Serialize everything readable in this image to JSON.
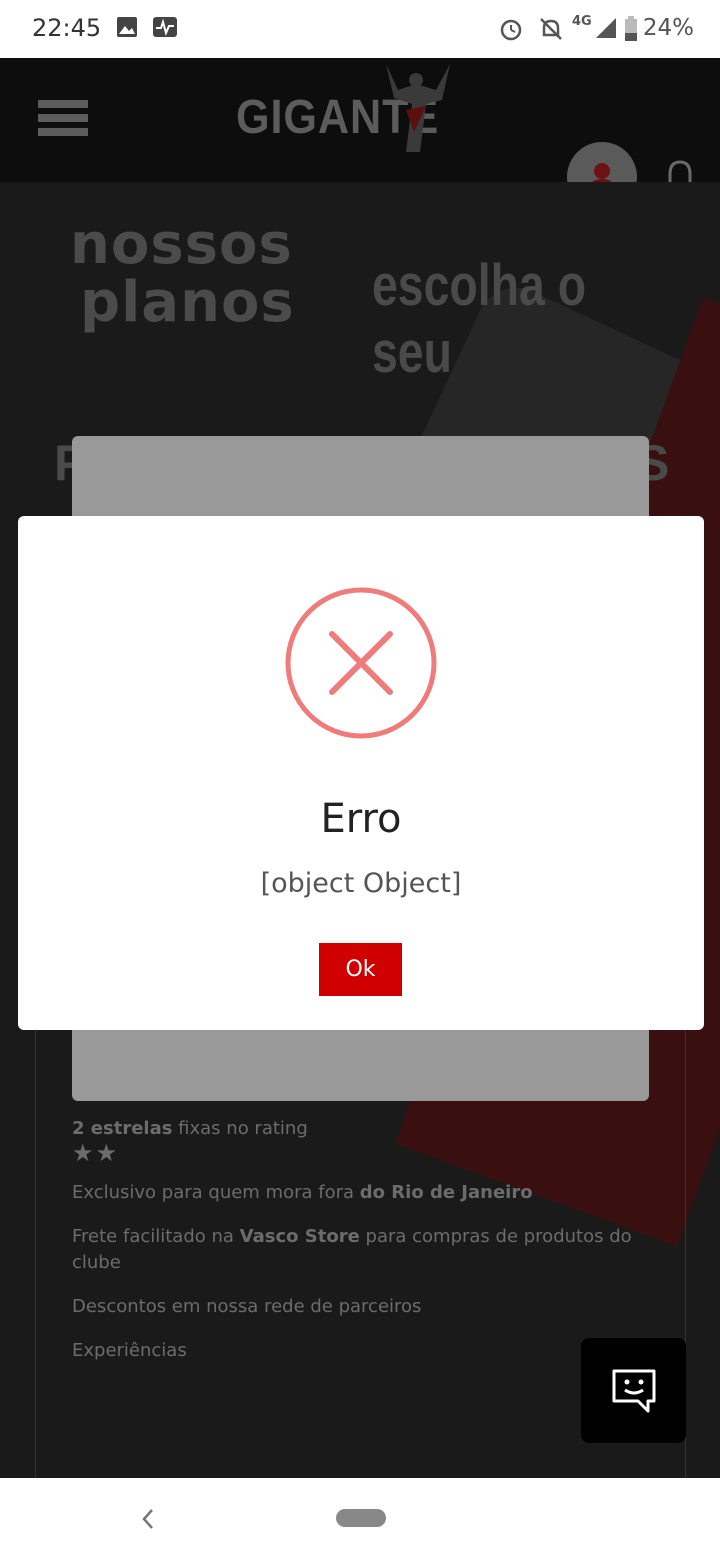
{
  "status_bar": {
    "time": "22:45",
    "network": "4G",
    "battery": "24%"
  },
  "header": {
    "logo_text": "GIGANTE"
  },
  "page": {
    "heading_line1": "nossos",
    "heading_line2": "planos",
    "subheading": "escolha o seu",
    "benefits": [
      {
        "bold": "2 estrelas",
        "text": " fixas no rating"
      },
      {
        "text": "Exclusivo para quem mora fora ",
        "bold_end": "do Rio de Janeiro"
      },
      {
        "text": "Frete facilitado na ",
        "bold_mid": "Vasco Store",
        "text_end": " para compras de produtos do clube"
      },
      {
        "text": "Descontos em nossa rede de parceiros"
      },
      {
        "text": "Experiências"
      }
    ],
    "stars": "★★"
  },
  "modal": {
    "title": "Erro",
    "message": "[object Object]",
    "ok_label": "Ok"
  },
  "colors": {
    "accent_red": "#d10000",
    "error_icon": "#f07b7b"
  }
}
